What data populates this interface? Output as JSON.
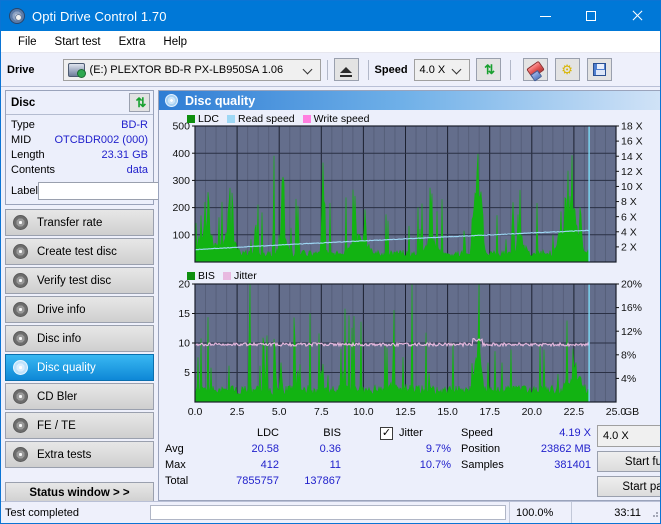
{
  "window": {
    "title": "Opti Drive Control 1.70",
    "icon": "disc-icon",
    "buttons": {
      "minimize": "minimize-icon",
      "maximize": "maximize-icon",
      "close": "close-icon"
    }
  },
  "menu": {
    "items": [
      "File",
      "Start test",
      "Extra",
      "Help"
    ]
  },
  "toolbar": {
    "drive_label": "Drive",
    "drive_value": "(E:)   PLEXTOR BD-R  PX-LB950SA 1.06",
    "eject_icon": "eject-icon",
    "speed_label": "Speed",
    "speed_value": "4.0 X",
    "refresh_icon": "refresh-icon",
    "erase_icon": "eraser-icon",
    "tools_icon": "gears-icon",
    "save_icon": "save-icon"
  },
  "disc_panel": {
    "title": "Disc",
    "refresh_icon": "refresh-icon",
    "rows": [
      {
        "key": "Type",
        "value": "BD-R"
      },
      {
        "key": "MID",
        "value": "OTCBDR002 (000)"
      },
      {
        "key": "Length",
        "value": "23.31 GB"
      },
      {
        "key": "Contents",
        "value": "data"
      }
    ],
    "label_key": "Label",
    "label_value": "",
    "label_placeholder": "",
    "disc_icon": "cd-icon"
  },
  "sidebar": {
    "items": [
      {
        "label": "Transfer rate",
        "icon": "disc-icon",
        "active": false
      },
      {
        "label": "Create test disc",
        "icon": "disc-icon",
        "active": false
      },
      {
        "label": "Verify test disc",
        "icon": "disc-icon",
        "active": false
      },
      {
        "label": "Drive info",
        "icon": "disc-icon",
        "active": false
      },
      {
        "label": "Disc info",
        "icon": "disc-icon",
        "active": false
      },
      {
        "label": "Disc quality",
        "icon": "disc-icon",
        "active": true
      },
      {
        "label": "CD Bler",
        "icon": "disc-icon",
        "active": false
      },
      {
        "label": "FE / TE",
        "icon": "disc-icon",
        "active": false
      },
      {
        "label": "Extra tests",
        "icon": "disc-icon",
        "active": false
      }
    ],
    "status_window": "Status window > >"
  },
  "panel": {
    "title": "Disc quality",
    "icon": "disc-quality-icon"
  },
  "colors": {
    "ldc_green": "#12b312",
    "read_speed": "#9ed8f5",
    "write_speed": "#ff7fe0",
    "jitter_pink": "#e8b9e0",
    "plot_bg": "#646e8c",
    "accent_blue": "#0078d7",
    "value_blue": "#2222cc"
  },
  "chart_data": [
    {
      "type": "area",
      "name": "LDC chart",
      "legend": [
        {
          "label": "LDC",
          "color": "#0f8f0f"
        },
        {
          "label": "Read speed",
          "color": "#9ed8f5"
        },
        {
          "label": "Write speed",
          "color": "#ff7fe0"
        }
      ],
      "legend_position": "top-left",
      "grid": true,
      "xlabel": "GB",
      "xlim": [
        0,
        25
      ],
      "xticks": [
        "0.0",
        "2.5",
        "5.0",
        "7.5",
        "10.0",
        "12.5",
        "15.0",
        "17.5",
        "20.0",
        "22.5",
        "25.0"
      ],
      "ylabel_left": "LDC",
      "ylim": [
        0,
        500
      ],
      "yticks_left": [
        "100",
        "200",
        "300",
        "400",
        "500"
      ],
      "ylabel_right": "X",
      "ylim_right": [
        0,
        18
      ],
      "yticks_right": [
        "2 X",
        "4 X",
        "6 X",
        "8 X",
        "10 X",
        "12 X",
        "14 X",
        "16 X",
        "18 X"
      ],
      "data_end_gb": 23.4,
      "read_speed_series": [
        {
          "x": 0.0,
          "y": 1.6
        },
        {
          "x": 1.0,
          "y": 1.9
        },
        {
          "x": 3.0,
          "y": 2.1
        },
        {
          "x": 6.0,
          "y": 2.4
        },
        {
          "x": 9.0,
          "y": 2.7
        },
        {
          "x": 12.0,
          "y": 3.0
        },
        {
          "x": 15.0,
          "y": 3.3
        },
        {
          "x": 18.0,
          "y": 3.6
        },
        {
          "x": 21.0,
          "y": 3.9
        },
        {
          "x": 23.4,
          "y": 4.19
        }
      ],
      "ldc_peaks_gb": [
        0.6,
        2.0,
        3.6,
        5.2,
        6.1,
        7.6,
        9.5,
        10.1,
        14.0,
        16.8,
        19.2,
        22.0,
        22.9
      ],
      "ldc_peak_values": [
        230,
        250,
        160,
        375,
        165,
        368,
        245,
        200,
        215,
        412,
        140,
        290,
        205
      ],
      "ldc_baseline": 30
    },
    {
      "type": "area",
      "name": "BIS chart",
      "legend": [
        {
          "label": "BIS",
          "color": "#0f8f0f"
        },
        {
          "label": "Jitter",
          "color": "#e8b9e0"
        }
      ],
      "legend_position": "top-left",
      "grid": true,
      "xlabel": "GB",
      "xlim": [
        0,
        25
      ],
      "xticks": [
        "0.0",
        "2.5",
        "5.0",
        "7.5",
        "10.0",
        "12.5",
        "15.0",
        "17.5",
        "20.0",
        "22.5",
        "25.0"
      ],
      "ylabel_left": "BIS",
      "ylim": [
        0,
        20
      ],
      "yticks_left": [
        "5",
        "10",
        "15",
        "20"
      ],
      "ylabel_right": "%",
      "ylim_right": [
        0,
        20
      ],
      "yticks_right": [
        "4%",
        "8%",
        "12%",
        "16%",
        "20%"
      ],
      "data_end_gb": 23.4,
      "jitter_series_avg": 9.7,
      "jitter_peak_gb": 16.8,
      "jitter_peak_value": 10.7,
      "bis_baseline": 3,
      "bis_peaks_gb": [
        5.1,
        6.1,
        7.5,
        16.8,
        22.6
      ],
      "bis_peak_values": [
        7,
        6,
        6,
        11,
        8
      ]
    }
  ],
  "results": {
    "columns": [
      "LDC",
      "BIS"
    ],
    "jitter_label": "Jitter",
    "jitter_checked": true,
    "rows": [
      {
        "name": "Avg",
        "ldc": "20.58",
        "bis": "0.36",
        "jitter": "9.7%"
      },
      {
        "name": "Max",
        "ldc": "412",
        "bis": "11",
        "jitter": "10.7%"
      },
      {
        "name": "Total",
        "ldc": "7855757",
        "bis": "137867",
        "jitter": ""
      }
    ],
    "speed_key": "Speed",
    "speed_value": "4.19 X",
    "position_key": "Position",
    "position_value": "23862 MB",
    "samples_key": "Samples",
    "samples_value": "381401",
    "speed_select": "4.0 X",
    "start_full": "Start full",
    "start_part": "Start part"
  },
  "statusbar": {
    "text": "Test completed",
    "percent": "100.0%",
    "progress": 100,
    "time": "33:11"
  }
}
